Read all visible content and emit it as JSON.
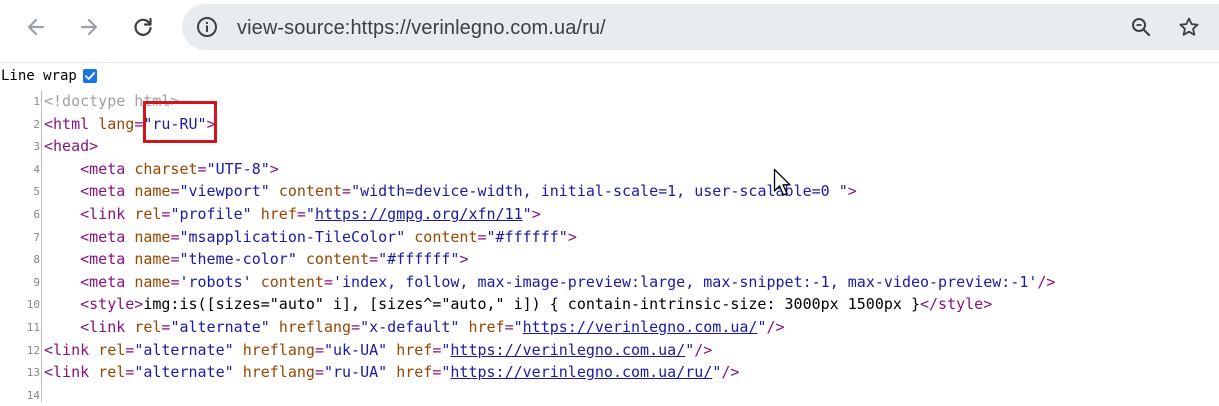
{
  "browser": {
    "url": "view-source:https://verinlegno.com.ua/ru/",
    "icons": [
      "back-arrow-icon",
      "forward-arrow-icon",
      "reload-icon",
      "site-info-icon",
      "zoom-icon",
      "bookmark-star-icon"
    ]
  },
  "viewer": {
    "line_wrap_label": "Line wrap",
    "line_wrap_checked": true
  },
  "source": {
    "lines": [
      {
        "n": "1",
        "indent": "",
        "parts": [
          [
            "dt",
            "<!doctype html>"
          ]
        ]
      },
      {
        "n": "2",
        "indent": "",
        "parts": [
          [
            "tag",
            "<html "
          ],
          [
            "an",
            "lang"
          ],
          [
            "tag",
            "="
          ],
          [
            "av",
            "\"ru-RU\""
          ],
          [
            "tag",
            ">"
          ]
        ]
      },
      {
        "n": "3",
        "indent": "",
        "parts": [
          [
            "tag",
            "<head>"
          ]
        ]
      },
      {
        "n": "4",
        "indent": "    ",
        "parts": [
          [
            "tag",
            "<meta "
          ],
          [
            "an",
            "charset"
          ],
          [
            "tag",
            "="
          ],
          [
            "av",
            "\"UTF-8\""
          ],
          [
            "tag",
            ">"
          ]
        ]
      },
      {
        "n": "5",
        "indent": "    ",
        "parts": [
          [
            "tag",
            "<meta "
          ],
          [
            "an",
            "name"
          ],
          [
            "tag",
            "="
          ],
          [
            "av",
            "\"viewport\""
          ],
          [
            "tag",
            " "
          ],
          [
            "an",
            "content"
          ],
          [
            "tag",
            "="
          ],
          [
            "av",
            "\"width=device-width, initial-scale=1, user-scalable=0 \""
          ],
          [
            "tag",
            ">"
          ]
        ]
      },
      {
        "n": "6",
        "indent": "    ",
        "parts": [
          [
            "tag",
            "<link "
          ],
          [
            "an",
            "rel"
          ],
          [
            "tag",
            "="
          ],
          [
            "av",
            "\"profile\""
          ],
          [
            "tag",
            " "
          ],
          [
            "an",
            "href"
          ],
          [
            "tag",
            "="
          ],
          [
            "av",
            "\""
          ],
          [
            "lnk",
            "https://gmpg.org/xfn/11"
          ],
          [
            "av",
            "\""
          ],
          [
            "tag",
            ">"
          ]
        ]
      },
      {
        "n": "7",
        "indent": "    ",
        "parts": [
          [
            "tag",
            "<meta "
          ],
          [
            "an",
            "name"
          ],
          [
            "tag",
            "="
          ],
          [
            "av",
            "\"msapplication-TileColor\""
          ],
          [
            "tag",
            " "
          ],
          [
            "an",
            "content"
          ],
          [
            "tag",
            "="
          ],
          [
            "av",
            "\"#ffffff\""
          ],
          [
            "tag",
            ">"
          ]
        ]
      },
      {
        "n": "8",
        "indent": "    ",
        "parts": [
          [
            "tag",
            "<meta "
          ],
          [
            "an",
            "name"
          ],
          [
            "tag",
            "="
          ],
          [
            "av",
            "\"theme-color\""
          ],
          [
            "tag",
            " "
          ],
          [
            "an",
            "content"
          ],
          [
            "tag",
            "="
          ],
          [
            "av",
            "\"#ffffff\""
          ],
          [
            "tag",
            ">"
          ]
        ]
      },
      {
        "n": "9",
        "indent": "    ",
        "parts": [
          [
            "tag",
            "<meta "
          ],
          [
            "an",
            "name"
          ],
          [
            "tag",
            "="
          ],
          [
            "av",
            "'robots'"
          ],
          [
            "tag",
            " "
          ],
          [
            "an",
            "content"
          ],
          [
            "tag",
            "="
          ],
          [
            "av",
            "'index, follow, max-image-preview:large, max-snippet:-1, max-video-preview:-1'"
          ],
          [
            "tag",
            "/>"
          ]
        ]
      },
      {
        "n": "10",
        "indent": "    ",
        "parts": [
          [
            "tag",
            "<style>"
          ],
          [
            "txt",
            "img:is([sizes=\"auto\" i], [sizes^=\"auto,\" i]) { contain-intrinsic-size: 3000px 1500px }"
          ],
          [
            "tag",
            "</style>"
          ]
        ]
      },
      {
        "n": "11",
        "indent": "    ",
        "parts": [
          [
            "tag",
            "<link "
          ],
          [
            "an",
            "rel"
          ],
          [
            "tag",
            "="
          ],
          [
            "av",
            "\"alternate\""
          ],
          [
            "tag",
            " "
          ],
          [
            "an",
            "hreflang"
          ],
          [
            "tag",
            "="
          ],
          [
            "av",
            "\"x-default\""
          ],
          [
            "tag",
            " "
          ],
          [
            "an",
            "href"
          ],
          [
            "tag",
            "="
          ],
          [
            "av",
            "\""
          ],
          [
            "lnk",
            "https://verinlegno.com.ua/"
          ],
          [
            "av",
            "\""
          ],
          [
            "tag",
            "/>"
          ]
        ]
      },
      {
        "n": "12",
        "indent": "",
        "parts": [
          [
            "tag",
            "<link "
          ],
          [
            "an",
            "rel"
          ],
          [
            "tag",
            "="
          ],
          [
            "av",
            "\"alternate\""
          ],
          [
            "tag",
            " "
          ],
          [
            "an",
            "hreflang"
          ],
          [
            "tag",
            "="
          ],
          [
            "av",
            "\"uk-UA\""
          ],
          [
            "tag",
            " "
          ],
          [
            "an",
            "href"
          ],
          [
            "tag",
            "="
          ],
          [
            "av",
            "\""
          ],
          [
            "lnk",
            "https://verinlegno.com.ua/"
          ],
          [
            "av",
            "\""
          ],
          [
            "tag",
            "/>"
          ]
        ]
      },
      {
        "n": "13",
        "indent": "",
        "parts": [
          [
            "tag",
            "<link "
          ],
          [
            "an",
            "rel"
          ],
          [
            "tag",
            "="
          ],
          [
            "av",
            "\"alternate\""
          ],
          [
            "tag",
            " "
          ],
          [
            "an",
            "hreflang"
          ],
          [
            "tag",
            "="
          ],
          [
            "av",
            "\"ru-UA\""
          ],
          [
            "tag",
            " "
          ],
          [
            "an",
            "href"
          ],
          [
            "tag",
            "="
          ],
          [
            "av",
            "\""
          ],
          [
            "lnk",
            "https://verinlegno.com.ua/ru/"
          ],
          [
            "av",
            "\""
          ],
          [
            "tag",
            "/>"
          ]
        ]
      },
      {
        "n": "14",
        "indent": "",
        "parts": []
      }
    ]
  }
}
